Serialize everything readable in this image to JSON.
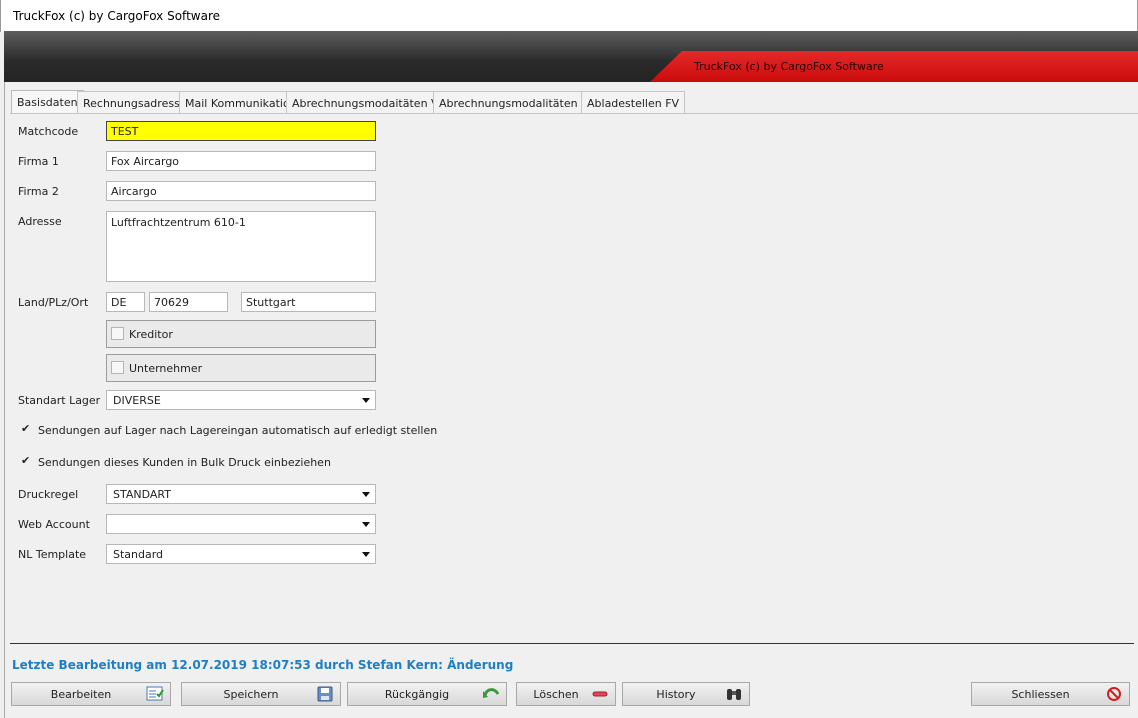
{
  "window": {
    "title": "TruckFox (c) by CargoFox Software"
  },
  "banner": {
    "text": "TruckFox (c) by CargoFox Software"
  },
  "tabs": [
    {
      "label": "Basisdaten",
      "active": true
    },
    {
      "label": "Rechnungsadresse"
    },
    {
      "label": "Mail Kommunikation"
    },
    {
      "label": "Abrechnungsmodaitäten VK"
    },
    {
      "label": "Abrechnungsmodalitäten EK"
    },
    {
      "label": "Abladestellen FV"
    }
  ],
  "form": {
    "matchcode": {
      "label": "Matchcode",
      "value": "TEST",
      "highlight": "#ffff00"
    },
    "firma1": {
      "label": "Firma 1",
      "value": "Fox Aircargo"
    },
    "firma2": {
      "label": "Firma 2",
      "value": "Aircargo"
    },
    "adresse": {
      "label": "Adresse",
      "value": "Luftfrachtzentrum 610-1"
    },
    "land_plz_ort": {
      "label": "Land/PLz/Ort",
      "land": "DE",
      "plz": "70629",
      "ort": "Stuttgart"
    },
    "kreditor": {
      "label": "Kreditor",
      "checked": false
    },
    "unternehmer": {
      "label": "Unternehmer",
      "checked": false
    },
    "standart_lager": {
      "label": "Standart Lager",
      "value": "DIVERSE"
    },
    "auto_erledigt": {
      "label": "Sendungen auf Lager nach Lagereingan automatisch auf erledigt stellen",
      "checked": true
    },
    "bulk_druck": {
      "label": "Sendungen dieses Kunden in Bulk Druck einbeziehen",
      "checked": true
    },
    "druckregel": {
      "label": "Druckregel",
      "value": "STANDART"
    },
    "web_account": {
      "label": "Web Account",
      "value": ""
    },
    "nl_template": {
      "label": "NL Template",
      "value": "Standard"
    }
  },
  "status": {
    "text": "Letzte Bearbeitung am 12.07.2019 18:07:53 durch Stefan Kern: Änderung",
    "color": "#1f7fc4"
  },
  "buttons": {
    "bearbeiten": {
      "label": "Bearbeiten",
      "icon": "edit-list-icon"
    },
    "speichern": {
      "label": "Speichern",
      "icon": "save-icon"
    },
    "rueckgaengig": {
      "label": "Rückgängig",
      "icon": "undo-icon"
    },
    "loeschen": {
      "label": "Löschen",
      "icon": "delete-icon"
    },
    "history": {
      "label": "History",
      "icon": "binoculars-icon"
    },
    "schliessen": {
      "label": "Schliessen",
      "icon": "close-forbidden-icon"
    }
  },
  "colors": {
    "accent": "#1f7fc4",
    "banner_red": "#d41414",
    "highlight": "#ffff00"
  }
}
